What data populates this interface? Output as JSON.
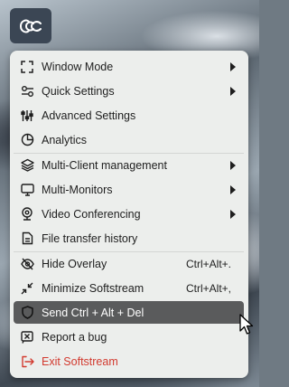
{
  "menu": {
    "items": [
      {
        "label": "Window Mode",
        "icon": "expand-corners-icon",
        "submenu": true
      },
      {
        "label": "Quick Settings",
        "icon": "toggle-icon",
        "submenu": true
      },
      {
        "label": "Advanced Settings",
        "icon": "sliders-icon",
        "submenu": false
      },
      {
        "label": "Analytics",
        "icon": "pie-chart-icon",
        "submenu": false
      },
      {
        "label": "Multi-Client management",
        "icon": "layers-icon",
        "submenu": true
      },
      {
        "label": "Multi-Monitors",
        "icon": "monitor-icon",
        "submenu": true
      },
      {
        "label": "Video Conferencing",
        "icon": "webcam-icon",
        "submenu": true
      },
      {
        "label": "File transfer history",
        "icon": "document-icon",
        "submenu": false
      },
      {
        "label": "Hide Overlay",
        "icon": "eye-off-icon",
        "shortcut": "Ctrl+Alt+."
      },
      {
        "label": "Minimize Softstream",
        "icon": "minimize-arrows-icon",
        "shortcut": "Ctrl+Alt+,"
      },
      {
        "label": "Send Ctrl + Alt + Del",
        "icon": "shield-icon",
        "highlighted": true
      },
      {
        "label": "Report a bug",
        "icon": "bug-report-icon"
      },
      {
        "label": "Exit Softstream",
        "icon": "exit-icon",
        "color": "#d23a2f"
      }
    ]
  },
  "colors": {
    "menu_bg": "#eceeec",
    "highlight_bg": "#5a5b5c",
    "logo_bg": "#3b4654",
    "exit_text": "#d23a2f"
  }
}
